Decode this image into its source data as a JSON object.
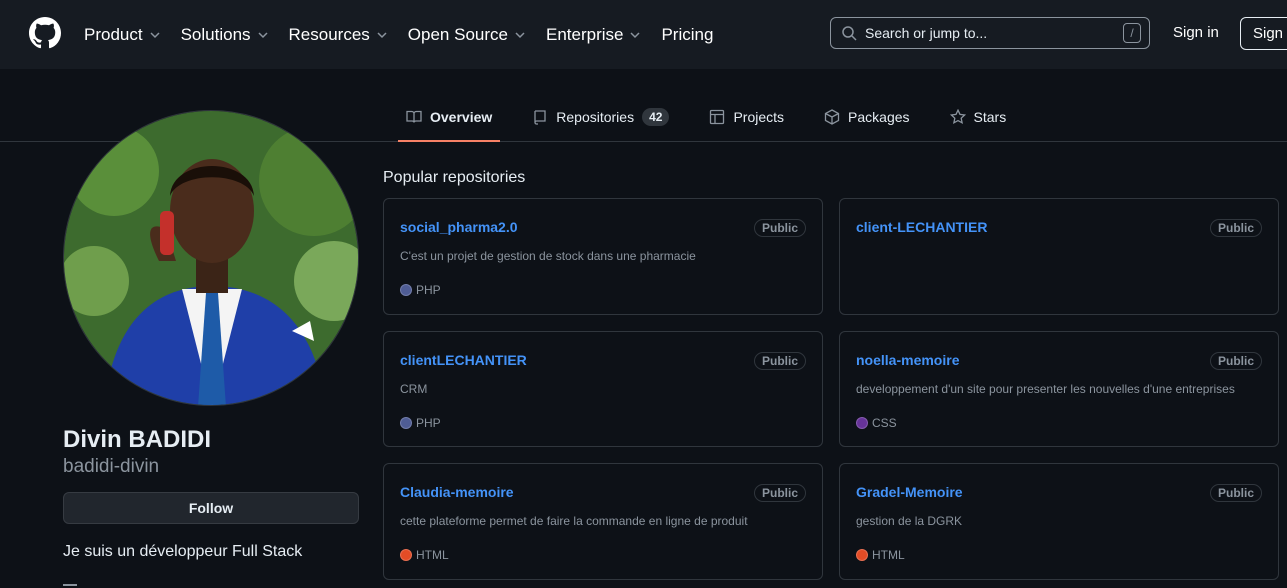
{
  "header": {
    "nav": [
      {
        "label": "Product"
      },
      {
        "label": "Solutions"
      },
      {
        "label": "Resources"
      },
      {
        "label": "Open Source"
      },
      {
        "label": "Enterprise"
      },
      {
        "label": "Pricing"
      }
    ],
    "search_placeholder": "Search or jump to...",
    "search_shortcut": "/",
    "signin": "Sign in",
    "signup": "Sign up"
  },
  "tabs": [
    {
      "label": "Overview",
      "icon": "book-icon",
      "active": true
    },
    {
      "label": "Repositories",
      "icon": "repo-icon",
      "count": "42"
    },
    {
      "label": "Projects",
      "icon": "table-icon"
    },
    {
      "label": "Packages",
      "icon": "package-icon"
    },
    {
      "label": "Stars",
      "icon": "star-icon"
    }
  ],
  "profile": {
    "name": "Divin BADIDI",
    "login": "badidi-divin",
    "follow": "Follow",
    "bio": "Je suis un développeur Full Stack"
  },
  "popular": {
    "title": "Popular repositories",
    "repos": [
      {
        "name": "social_pharma2.0",
        "visibility": "Public",
        "description": "C'est un projet de gestion de stock dans une pharmacie",
        "language": "PHP",
        "color": "#4F5D95"
      },
      {
        "name": "client-LECHANTIER",
        "visibility": "Public",
        "description": "",
        "language": "",
        "color": ""
      },
      {
        "name": "clientLECHANTIER",
        "visibility": "Public",
        "description": "CRM",
        "language": "PHP",
        "color": "#4F5D95"
      },
      {
        "name": "noella-memoire",
        "visibility": "Public",
        "description": "developpement d'un site pour presenter les nouvelles d'une entreprises",
        "language": "CSS",
        "color": "#663399"
      },
      {
        "name": "Claudia-memoire",
        "visibility": "Public",
        "description": "cette plateforme permet de faire la commande en ligne de produit",
        "language": "HTML",
        "color": "#e34c26"
      },
      {
        "name": "Gradel-Memoire",
        "visibility": "Public",
        "description": "gestion de la DGRK",
        "language": "HTML",
        "color": "#e34c26"
      }
    ]
  },
  "colors": {
    "accent": "#f78166",
    "link": "#4493f8",
    "bg": "#0d1117",
    "header_bg": "#161b22"
  }
}
